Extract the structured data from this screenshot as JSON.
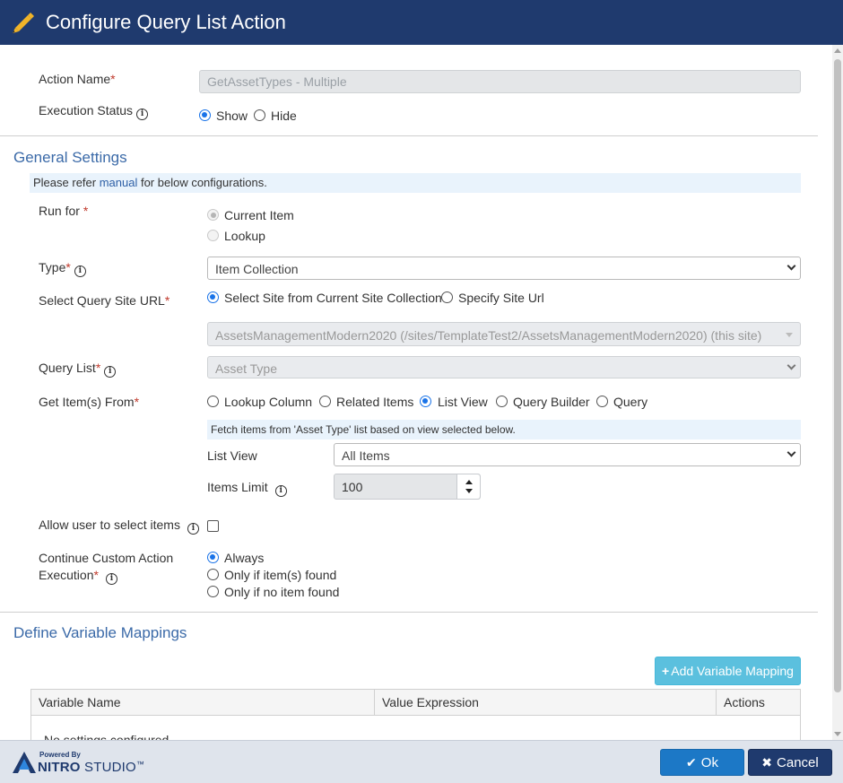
{
  "header": {
    "title": "Configure Query List Action",
    "icon": "pencil-icon"
  },
  "form": {
    "action_name": {
      "label": "Action Name",
      "value": "GetAssetTypes - Multiple"
    },
    "execution_status": {
      "label": "Execution Status",
      "options": [
        "Show",
        "Hide"
      ],
      "selected": "Show"
    }
  },
  "general": {
    "title": "General Settings",
    "refer_prefix": "Please refer ",
    "refer_link": "manual",
    "refer_suffix": " for below configurations.",
    "run_for": {
      "label": "Run for ",
      "options": [
        "Current Item",
        "Lookup"
      ],
      "selected": "Current Item"
    },
    "type": {
      "label": "Type",
      "value": "Item Collection"
    },
    "site_url": {
      "label": "Select Query Site URL",
      "options": [
        "Select Site from Current Site Collection",
        "Specify Site Url"
      ],
      "selected": "Select Site from Current Site Collection",
      "site_value": "AssetsManagementModern2020 (/sites/TemplateTest2/AssetsManagementModern2020) (this site)"
    },
    "query_list": {
      "label": "Query List",
      "value": "Asset Type"
    },
    "get_items": {
      "label": "Get Item(s) From",
      "options": [
        "Lookup Column",
        "Related Items",
        "List View",
        "Query Builder",
        "Query"
      ],
      "selected": "List View"
    },
    "fetch_note": "Fetch items from 'Asset Type' list based on view selected below.",
    "list_view": {
      "label": "List View",
      "value": "All Items"
    },
    "items_limit": {
      "label": "Items Limit",
      "value": "100"
    },
    "allow_select": {
      "label": "Allow user to select items",
      "checked": false
    },
    "continue_exec": {
      "label_line1": "Continue Custom Action",
      "label_line2": "Execution",
      "options": [
        "Always",
        "Only if item(s) found",
        "Only if no item found"
      ],
      "selected": "Always"
    }
  },
  "mappings": {
    "title": "Define Variable Mappings",
    "add_button": "Add Variable Mapping",
    "columns": [
      "Variable Name",
      "Value Expression",
      "Actions"
    ],
    "empty_text": "No settings configured"
  },
  "footer": {
    "powered_by": "Powered By",
    "brand_bold": "NITRO",
    "brand_light": " STUDIO",
    "brand_tm": "™",
    "ok_label": "Ok",
    "cancel_label": "Cancel"
  },
  "colors": {
    "header_bg": "#1f3a6e",
    "section_title": "#3b6aa8",
    "ok_bg": "#1c78c6",
    "add_bg": "#5bc0de",
    "required": "#c0392b"
  }
}
